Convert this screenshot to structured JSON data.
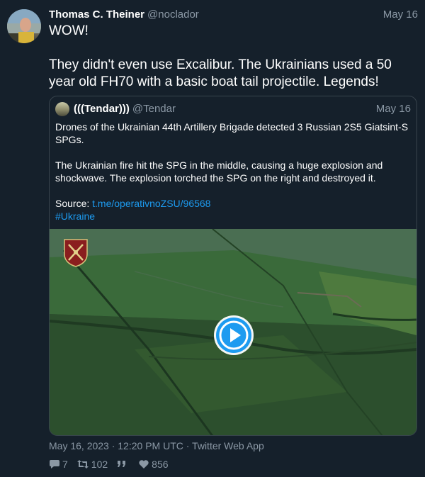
{
  "tweet": {
    "author_name": "Thomas C. Theiner",
    "author_handle": "@noclador",
    "date": "May 16",
    "text": "WOW!\n\nThey didn't even use Excalibur. The Ukrainians used a 50 year old FH70 with a basic boat tail projectile. Legends!",
    "timestamp": "May 16, 2023 · 12:20 PM UTC · Twitter Web App",
    "replies": "7",
    "retweets": "102",
    "likes": "856"
  },
  "quote": {
    "author_name": "(((Tendar)))",
    "author_handle": "@Tendar",
    "date": "May 16",
    "para1": "Drones of the Ukrainian 44th Artillery Brigade detected 3 Russian 2S5 Giatsint-S SPGs.",
    "para2": "The Ukrainian fire hit the SPG in the middle, causing a huge explosion and shockwave. The explosion torched the SPG on the right and destroyed it.",
    "source_label": "Source: ",
    "source_link": "t.me/operativnoZSU/96568",
    "hashtag": "#Ukraine"
  },
  "icons": {
    "replies": "comment-icon",
    "retweets": "retweet-icon",
    "quotes": "quote-icon",
    "likes": "heart-icon",
    "play": "play-icon",
    "emblem": "brigade-emblem-icon"
  },
  "colors": {
    "background": "#15202b",
    "accent": "#1d9bf0",
    "secondary_text": "#8b98a5",
    "border": "#38444d"
  }
}
